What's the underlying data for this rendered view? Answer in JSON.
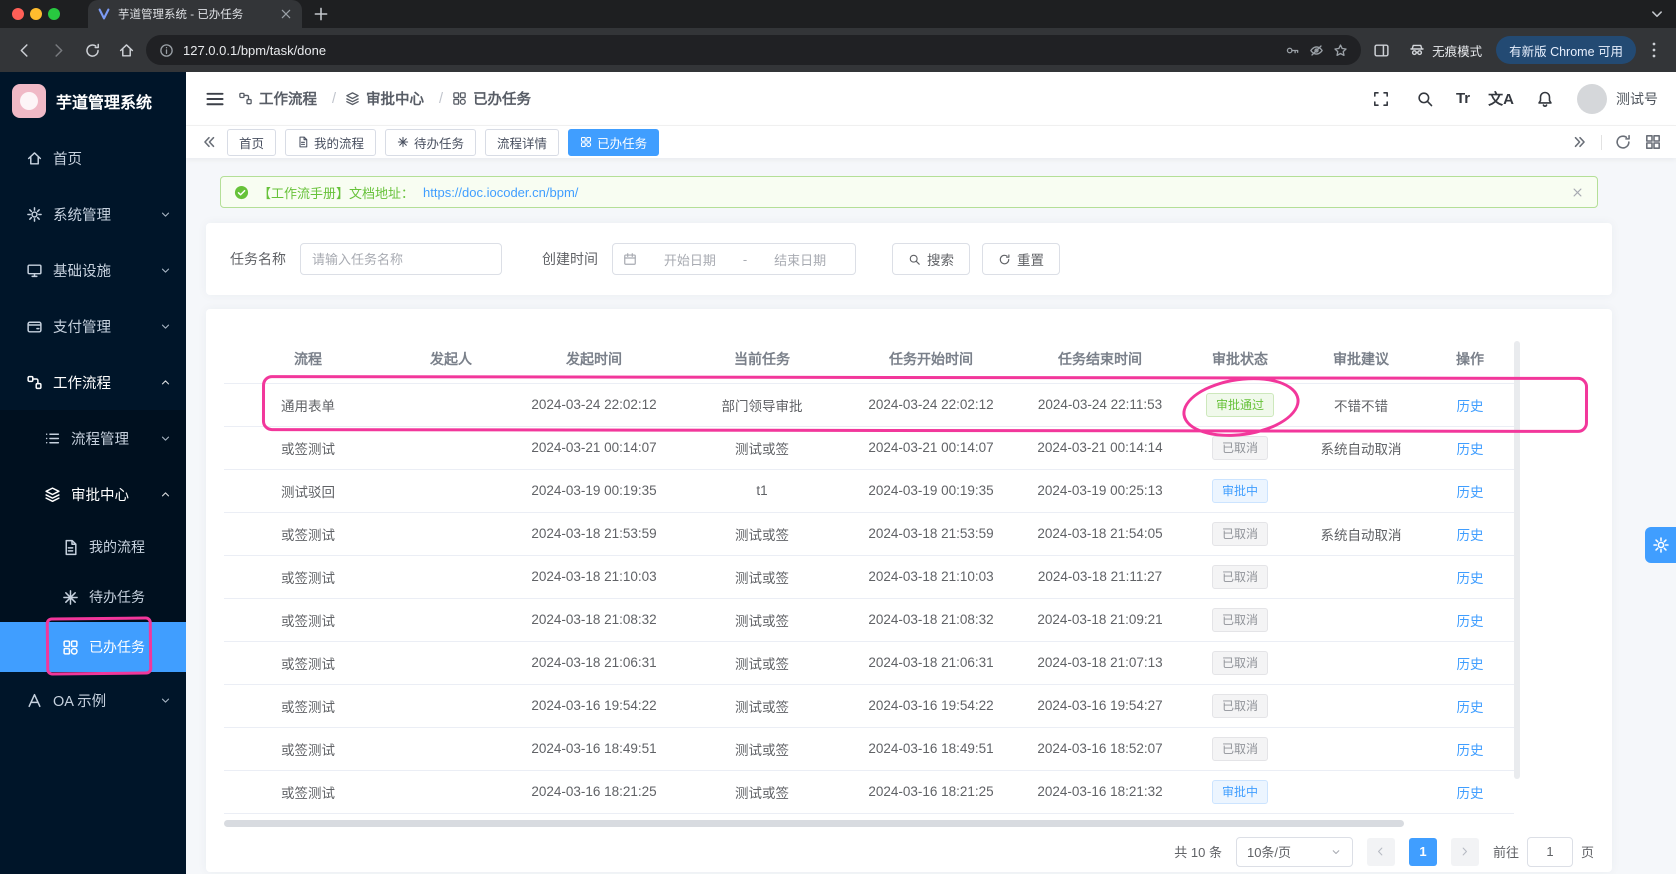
{
  "colors": {
    "accent": "#409eff",
    "annotation": "#f2379b",
    "sidebar_bg": "#001529",
    "sidebar_sub_bg": "#00101f",
    "success": "#67c23a",
    "info": "#909399"
  },
  "browser": {
    "tab_title": "芋道管理系统 - 已办任务",
    "url": "127.0.0.1/bpm/task/done",
    "incognito_label": "无痕模式",
    "update_label": "有新版 Chrome 可用"
  },
  "sidebar": {
    "logo_text": "芋道管理系统",
    "items": [
      {
        "label": "首页",
        "icon": "home",
        "level": 1
      },
      {
        "label": "系统管理",
        "icon": "gear",
        "level": 1,
        "chevron": "chevron-down"
      },
      {
        "label": "基础设施",
        "icon": "monitor",
        "level": 1,
        "chevron": "chevron-down"
      },
      {
        "label": "支付管理",
        "icon": "wallet",
        "level": 1,
        "chevron": "chevron-down"
      },
      {
        "label": "工作流程",
        "icon": "flow",
        "level": 1,
        "chevron": "chevron-up",
        "open": true
      },
      {
        "label": "流程管理",
        "icon": "list",
        "level": 2,
        "sub": true,
        "chevron": "chevron-down"
      },
      {
        "label": "审批中心",
        "icon": "stack",
        "level": 2,
        "sub": true,
        "chevron": "chevron-up",
        "open": true
      },
      {
        "label": "我的流程",
        "icon": "doc",
        "level": 3,
        "sub": true
      },
      {
        "label": "待办任务",
        "icon": "todo",
        "level": 3,
        "sub": true
      },
      {
        "label": "已办任务",
        "icon": "done",
        "level": 3,
        "sub": true,
        "active": true
      },
      {
        "label": "OA 示例",
        "icon": "oa",
        "level": 1,
        "chevron": "chevron-down"
      }
    ]
  },
  "header": {
    "breadcrumb": [
      {
        "label": "工作流程",
        "icon": "flow"
      },
      {
        "label": "审批中心",
        "icon": "stack"
      },
      {
        "label": "已办任务",
        "icon": "done"
      }
    ],
    "font_size_icon_text": "Tr",
    "translate_icon_text": "文A",
    "username": "测试号"
  },
  "tabbar": {
    "tabs": [
      {
        "label": "首页"
      },
      {
        "label": "我的流程",
        "icon": "doc"
      },
      {
        "label": "待办任务",
        "icon": "todo"
      },
      {
        "label": "流程详情"
      },
      {
        "label": "已办任务",
        "icon": "done",
        "active": true
      }
    ]
  },
  "alert": {
    "text": "【工作流手册】文档地址：",
    "link": "https://doc.iocoder.cn/bpm/"
  },
  "filters": {
    "task_name_label": "任务名称",
    "task_name_placeholder": "请输入任务名称",
    "create_time_label": "创建时间",
    "start_placeholder": "开始日期",
    "range_separator": "-",
    "end_placeholder": "结束日期",
    "search_label": "搜索",
    "reset_label": "重置"
  },
  "table": {
    "columns": [
      "流程",
      "发起人",
      "发起时间",
      "当前任务",
      "任务开始时间",
      "任务结束时间",
      "审批状态",
      "审批建议",
      "操作"
    ],
    "action_label": "历史",
    "rows": [
      {
        "process": "通用表单",
        "initiator": "",
        "start_time": "2024-03-24 22:02:12",
        "current_task": "部门领导审批",
        "task_start": "2024-03-24 22:02:12",
        "task_end": "2024-03-24 22:11:53",
        "status": "审批通过",
        "status_type": "success",
        "suggestion": "不错不错"
      },
      {
        "process": "或签测试",
        "initiator": "",
        "start_time": "2024-03-21 00:14:07",
        "current_task": "测试或签",
        "task_start": "2024-03-21 00:14:07",
        "task_end": "2024-03-21 00:14:14",
        "status": "已取消",
        "status_type": "info",
        "suggestion": "系统自动取消"
      },
      {
        "process": "测试驳回",
        "initiator": "",
        "start_time": "2024-03-19 00:19:35",
        "current_task": "t1",
        "task_start": "2024-03-19 00:19:35",
        "task_end": "2024-03-19 00:25:13",
        "status": "审批中",
        "status_type": "primary",
        "suggestion": ""
      },
      {
        "process": "或签测试",
        "initiator": "",
        "start_time": "2024-03-18 21:53:59",
        "current_task": "测试或签",
        "task_start": "2024-03-18 21:53:59",
        "task_end": "2024-03-18 21:54:05",
        "status": "已取消",
        "status_type": "info",
        "suggestion": "系统自动取消"
      },
      {
        "process": "或签测试",
        "initiator": "",
        "start_time": "2024-03-18 21:10:03",
        "current_task": "测试或签",
        "task_start": "2024-03-18 21:10:03",
        "task_end": "2024-03-18 21:11:27",
        "status": "已取消",
        "status_type": "info",
        "suggestion": ""
      },
      {
        "process": "或签测试",
        "initiator": "",
        "start_time": "2024-03-18 21:08:32",
        "current_task": "测试或签",
        "task_start": "2024-03-18 21:08:32",
        "task_end": "2024-03-18 21:09:21",
        "status": "已取消",
        "status_type": "info",
        "suggestion": ""
      },
      {
        "process": "或签测试",
        "initiator": "",
        "start_time": "2024-03-18 21:06:31",
        "current_task": "测试或签",
        "task_start": "2024-03-18 21:06:31",
        "task_end": "2024-03-18 21:07:13",
        "status": "已取消",
        "status_type": "info",
        "suggestion": ""
      },
      {
        "process": "或签测试",
        "initiator": "",
        "start_time": "2024-03-16 19:54:22",
        "current_task": "测试或签",
        "task_start": "2024-03-16 19:54:22",
        "task_end": "2024-03-16 19:54:27",
        "status": "已取消",
        "status_type": "info",
        "suggestion": ""
      },
      {
        "process": "或签测试",
        "initiator": "",
        "start_time": "2024-03-16 18:49:51",
        "current_task": "测试或签",
        "task_start": "2024-03-16 18:49:51",
        "task_end": "2024-03-16 18:52:07",
        "status": "已取消",
        "status_type": "info",
        "suggestion": ""
      },
      {
        "process": "或签测试",
        "initiator": "",
        "start_time": "2024-03-16 18:21:25",
        "current_task": "测试或签",
        "task_start": "2024-03-16 18:21:25",
        "task_end": "2024-03-16 18:21:32",
        "status": "审批中",
        "status_type": "primary",
        "suggestion": ""
      }
    ]
  },
  "pagination": {
    "total_label": "共 10 条",
    "page_size_label": "10条/页",
    "current_page": "1",
    "goto_label": "前往",
    "goto_value": "1",
    "page_unit_label": "页"
  }
}
